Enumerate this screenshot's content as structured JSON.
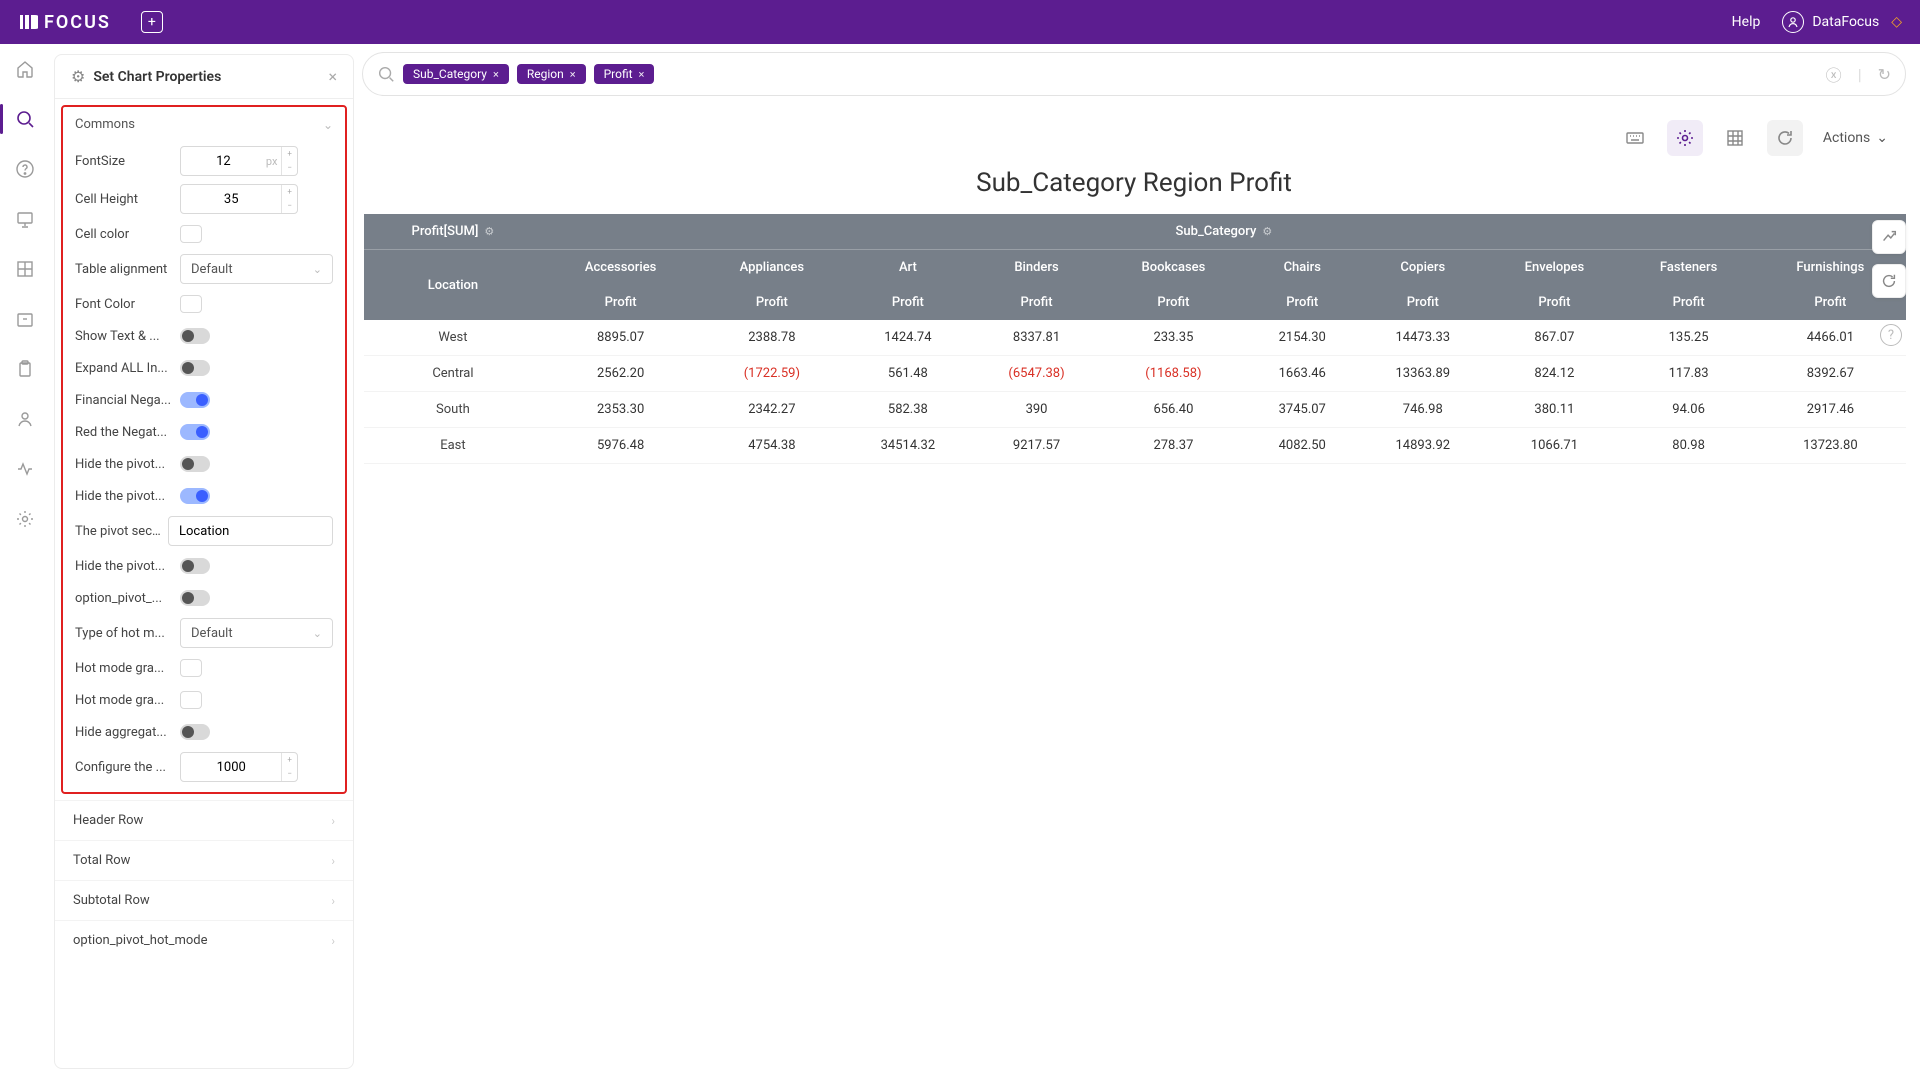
{
  "topbar": {
    "brand": "FOCUS",
    "help": "Help",
    "user": "DataFocus"
  },
  "panel": {
    "title": "Set Chart Properties",
    "commons_label": "Commons",
    "fontSize": {
      "label": "FontSize",
      "value": "12",
      "unit": "px"
    },
    "cellHeight": {
      "label": "Cell Height",
      "value": "35"
    },
    "cellColor": {
      "label": "Cell color"
    },
    "tableAlign": {
      "label": "Table alignment",
      "value": "Default"
    },
    "fontColor": {
      "label": "Font Color"
    },
    "showText": {
      "label": "Show Text & ...",
      "on": false
    },
    "expandAll": {
      "label": "Expand ALL In...",
      "on": false
    },
    "finNeg": {
      "label": "Financial Nega...",
      "on": true
    },
    "redNeg": {
      "label": "Red the Negat...",
      "on": true
    },
    "hidePivot1": {
      "label": "Hide the pivot...",
      "on": false
    },
    "hidePivot2": {
      "label": "Hide the pivot...",
      "on": true
    },
    "pivotSeco": {
      "label": "The pivot seco...",
      "value": "Location"
    },
    "hidePivot3": {
      "label": "Hide the pivot...",
      "on": false
    },
    "optionPivot": {
      "label": "option_pivot_...",
      "on": false
    },
    "hotMode": {
      "label": "Type of hot m...",
      "value": "Default"
    },
    "hotGrad1": {
      "label": "Hot mode gra..."
    },
    "hotGrad2": {
      "label": "Hot mode gra..."
    },
    "hideAgg": {
      "label": "Hide aggregat...",
      "on": false
    },
    "configure": {
      "label": "Configure the ...",
      "value": "1000"
    },
    "sections": {
      "header": "Header Row",
      "total": "Total Row",
      "subtotal": "Subtotal Row",
      "opt": "option_pivot_hot_mode"
    }
  },
  "search": {
    "pills": [
      "Sub_Category",
      "Region",
      "Profit"
    ]
  },
  "toolbar": {
    "actions": "Actions"
  },
  "title": "Sub_Category Region Profit",
  "chart_data": {
    "type": "table",
    "row_header_top": "Profit[SUM]",
    "col_header_top": "Sub_Category",
    "row_field": "Location",
    "value_label": "Profit",
    "categories": [
      "Accessories",
      "Appliances",
      "Art",
      "Binders",
      "Bookcases",
      "Chairs",
      "Copiers",
      "Envelopes",
      "Fasteners",
      "Furnishings"
    ],
    "rows": [
      {
        "name": "West",
        "values": [
          8895.07,
          2388.78,
          1424.74,
          8337.81,
          233.35,
          2154.3,
          14473.33,
          867.07,
          135.25,
          4466.01
        ]
      },
      {
        "name": "Central",
        "values": [
          2562.2,
          -1722.59,
          561.48,
          -6547.38,
          -1168.58,
          1663.46,
          13363.89,
          824.12,
          117.83,
          8392.67
        ]
      },
      {
        "name": "South",
        "values": [
          2353.3,
          2342.27,
          582.38,
          390,
          656.4,
          3745.07,
          746.98,
          380.11,
          94.06,
          2917.46
        ]
      },
      {
        "name": "East",
        "values": [
          5976.48,
          4754.38,
          34514.32,
          9217.57,
          278.37,
          4082.5,
          14893.92,
          1066.71,
          80.98,
          13723.8
        ]
      }
    ]
  }
}
